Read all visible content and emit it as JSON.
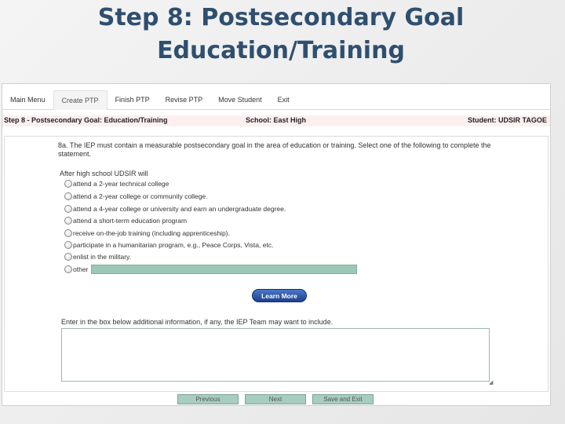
{
  "slide": {
    "title_line1": "Step 8: Postsecondary Goal",
    "title_line2": "Education/Training"
  },
  "menu": {
    "items": [
      {
        "label": "Main Menu"
      },
      {
        "label": "Create PTP"
      },
      {
        "label": "Finish PTP"
      },
      {
        "label": "Revise PTP"
      },
      {
        "label": "Move Student"
      },
      {
        "label": "Exit"
      }
    ]
  },
  "header": {
    "step": "Step 8 - Postsecondary Goal: Education/Training",
    "school": "School: East High",
    "student": "Student: UDSIR TAGOE"
  },
  "form": {
    "instruction": "8a. The IEP must contain a measurable postsecondary goal in the area of education or training. Select one of the following to complete the statement.",
    "prompt": "After high school UDSIR will",
    "options": [
      "attend a 2-year technical college",
      "attend a 2-year college or community college.",
      "attend a 4-year college or university and earn an undergraduate degree.",
      "attend a short-term education program",
      "receive on-the-job training (including apprenticeship).",
      "participate in a humanitarian program, e.g., Peace Corps, Vista, etc.",
      "enlist in the military.",
      "other"
    ],
    "other_value": "",
    "learn_more": "Learn More",
    "additional_label": "Enter in the box below additional information, if any, the IEP Team may want to include.",
    "additional_value": ""
  },
  "nav": {
    "previous": "Previous",
    "next": "Next",
    "save_exit": "Save and Exit"
  }
}
